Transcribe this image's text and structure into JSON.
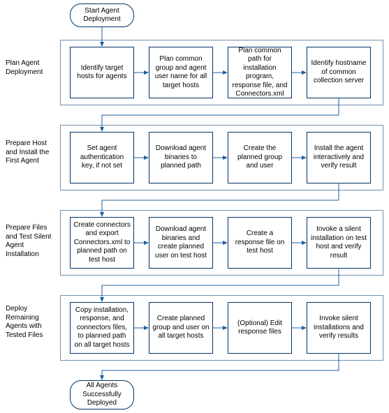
{
  "start": "Start Agent Deployment",
  "end": "All Agents Successfully Deployed",
  "phases": [
    {
      "label": "Plan Agent Deployment",
      "steps": [
        "Identify target hosts for agents",
        "Plan common group and agent user name for all target hosts",
        "Plan common path for installation program, response file, and Connectors.xml",
        "Identify hostname of common collection server"
      ]
    },
    {
      "label": "Prepare Host and Install the First Agent",
      "steps": [
        "Set agent authentication key, if not set",
        "Download agent binaries to planned path",
        "Create the planned group and user",
        "Install the agent interactively and verify result"
      ]
    },
    {
      "label": "Prepare Files and Test Silent Agent Installation",
      "steps": [
        "Create connectors and export Connectors.xml to planned path on test host",
        "Download agent binaries and create planned user on test host",
        "Create a response file on test host",
        "Invoke a silent installation on test host and verify result"
      ]
    },
    {
      "label": "Deploy Remaining Agents with Tested Files",
      "steps": [
        "Copy installation, response, and connectors files, to planned path on all target hosts",
        "Create planned group and user on all target hosts",
        "(Optional) Edit response files",
        "Invoke silent installations and verify results"
      ]
    }
  ]
}
